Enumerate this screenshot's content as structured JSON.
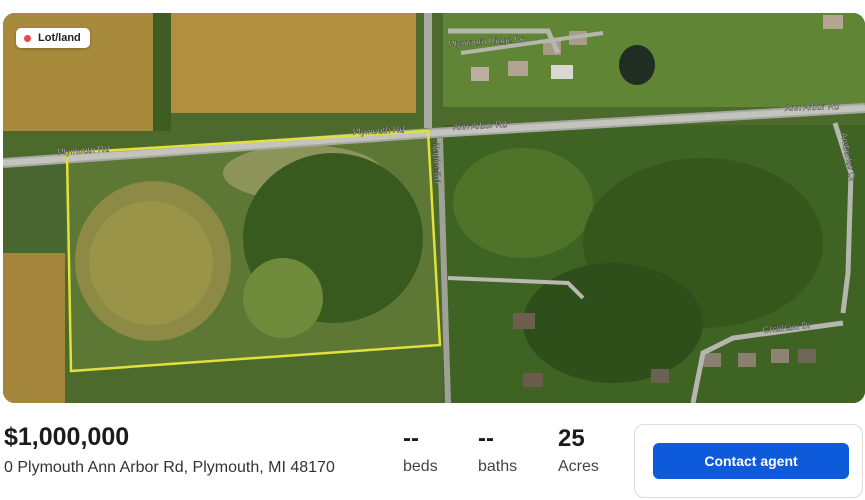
{
  "listing": {
    "badge_label": "Lot/land",
    "badge_color": "#e5484d",
    "price": "$1,000,000",
    "address": "0 Plymouth Ann Arbor Rd, Plymouth, MI 48170"
  },
  "stats": [
    {
      "value": "--",
      "label": "beds"
    },
    {
      "value": "--",
      "label": "baths"
    },
    {
      "value": "25",
      "label": "Acres"
    }
  ],
  "contact": {
    "button_label": "Contact agent",
    "button_color": "#0d5bdb"
  },
  "map_labels": {
    "plymouth_rd_left": "Plymouth Rd",
    "plymouth_rd_center": "Plymouth Rd",
    "ann_arbor_rd_center": "Ann Arbor Rd",
    "ann_arbor_rd_right": "Ann Arbor Rd",
    "plymouth_ridge_dr": "Plymouth Ridge Dr",
    "napier_rd": "Napier Rd",
    "amberly_dr": "Amberley Dr",
    "chatham_dr": "Chatham Dr"
  },
  "icons": {
    "status": "status-dot-icon"
  }
}
